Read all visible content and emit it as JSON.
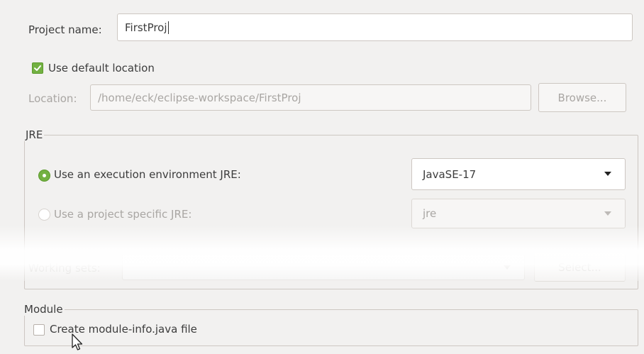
{
  "project": {
    "name_label": "Project name:",
    "name_value": "FirstProj",
    "use_default_location_label": "Use default location",
    "use_default_location_checked": true,
    "location_label": "Location:",
    "location_value": "/home/eck/eclipse-workspace/FirstProj",
    "browse_label": "Browse..."
  },
  "jre": {
    "group_title": "JRE",
    "exec_env_label": "Use an execution environment JRE:",
    "exec_env_selected": true,
    "exec_env_value": "JavaSE-17",
    "project_specific_label": "Use a project specific JRE:",
    "project_specific_value": "jre"
  },
  "working_sets": {
    "label": "Working sets:",
    "select_label": "Select..."
  },
  "module": {
    "group_title": "Module",
    "create_module_info_label": "Create module-info.java file",
    "create_module_info_checked": false
  },
  "icons": {
    "checkbox_check": "check-icon",
    "dropdown": "chevron-down-icon",
    "cursor": "mouse-pointer-icon"
  },
  "colors": {
    "accent_green": "#73b142",
    "background": "#f2f1f0"
  }
}
